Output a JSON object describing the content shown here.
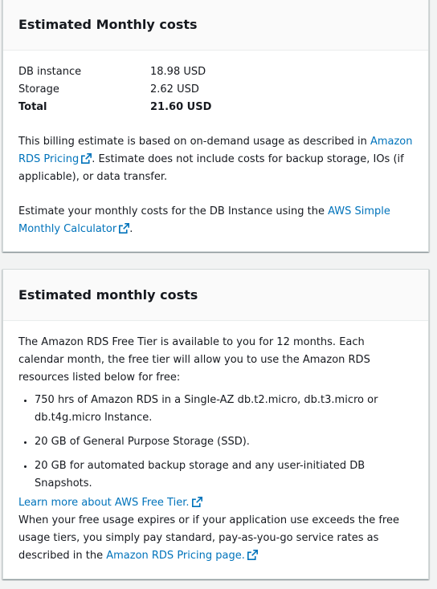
{
  "card1": {
    "title": "Estimated Monthly costs",
    "rows": [
      {
        "label": "DB instance",
        "value": "18.98 USD"
      },
      {
        "label": "Storage",
        "value": "2.62 USD"
      },
      {
        "label": "Total",
        "value": "21.60 USD"
      }
    ],
    "billing_text_1": "This billing estimate is based on on-demand usage as described in ",
    "billing_link": "Amazon RDS Pricing",
    "billing_text_2": ". Estimate does not include costs for backup storage, IOs (if applicable), or data transfer.",
    "calc_text_1": "Estimate your monthly costs for the DB Instance using the ",
    "calc_link": "AWS Simple Monthly Calculator",
    "calc_text_2": "."
  },
  "card2": {
    "title": "Estimated monthly costs",
    "intro": "The Amazon RDS Free Tier is available to you for 12 months. Each calendar month, the free tier will allow you to use the Amazon RDS resources listed below for free:",
    "bullets": [
      "750 hrs of Amazon RDS in a Single-AZ db.t2.micro, db.t3.micro or db.t4g.micro Instance.",
      "20 GB of General Purpose Storage (SSD).",
      "20 GB for automated backup storage and any user-initiated DB Snapshots."
    ],
    "learn_link": "Learn more about AWS Free Tier.",
    "expire_text": "When your free usage expires or if your application use exceeds the free usage tiers, you simply pay standard, pay-as-you-go service rates as described in the ",
    "pricing_link": "Amazon RDS Pricing page."
  },
  "colors": {
    "link": "#0073bb",
    "text": "#16191f",
    "background": "#f2f3f3"
  },
  "icons": {
    "external": "external-link-icon"
  }
}
